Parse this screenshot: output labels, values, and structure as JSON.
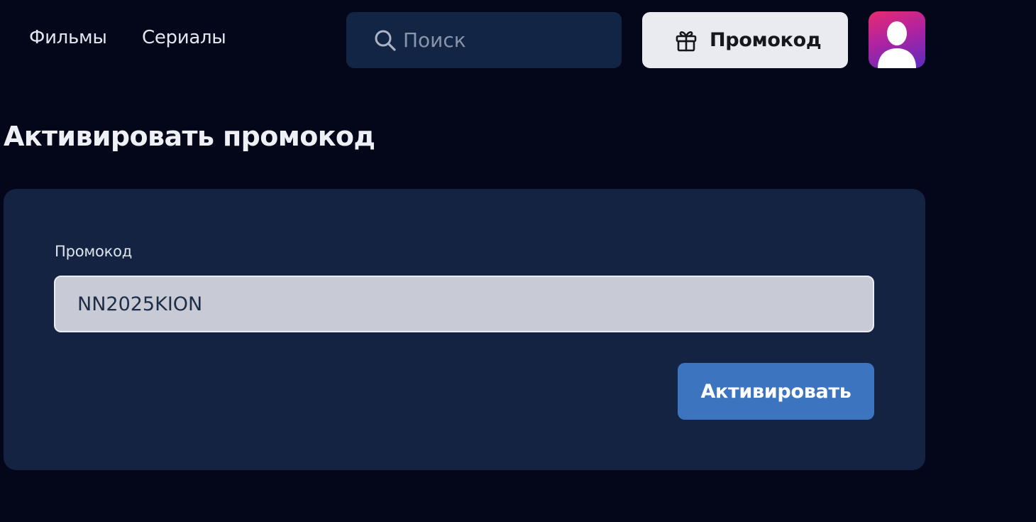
{
  "header": {
    "nav": [
      {
        "label": "Фильмы"
      },
      {
        "label": "Сериалы"
      }
    ],
    "search": {
      "icon": "search-icon",
      "placeholder": "Поиск",
      "value": ""
    },
    "promo_button": {
      "icon": "gift-icon",
      "label": "Промокод"
    },
    "avatar": {
      "icon": "user-icon"
    }
  },
  "main": {
    "title": "Активировать промокод",
    "form": {
      "field_label": "Промокод",
      "field_value": "NN2025KION",
      "submit_label": "Активировать"
    }
  },
  "colors": {
    "background": "#04061a",
    "card": "#132341",
    "search_bg": "#132544",
    "accent": "#3c74c0"
  }
}
